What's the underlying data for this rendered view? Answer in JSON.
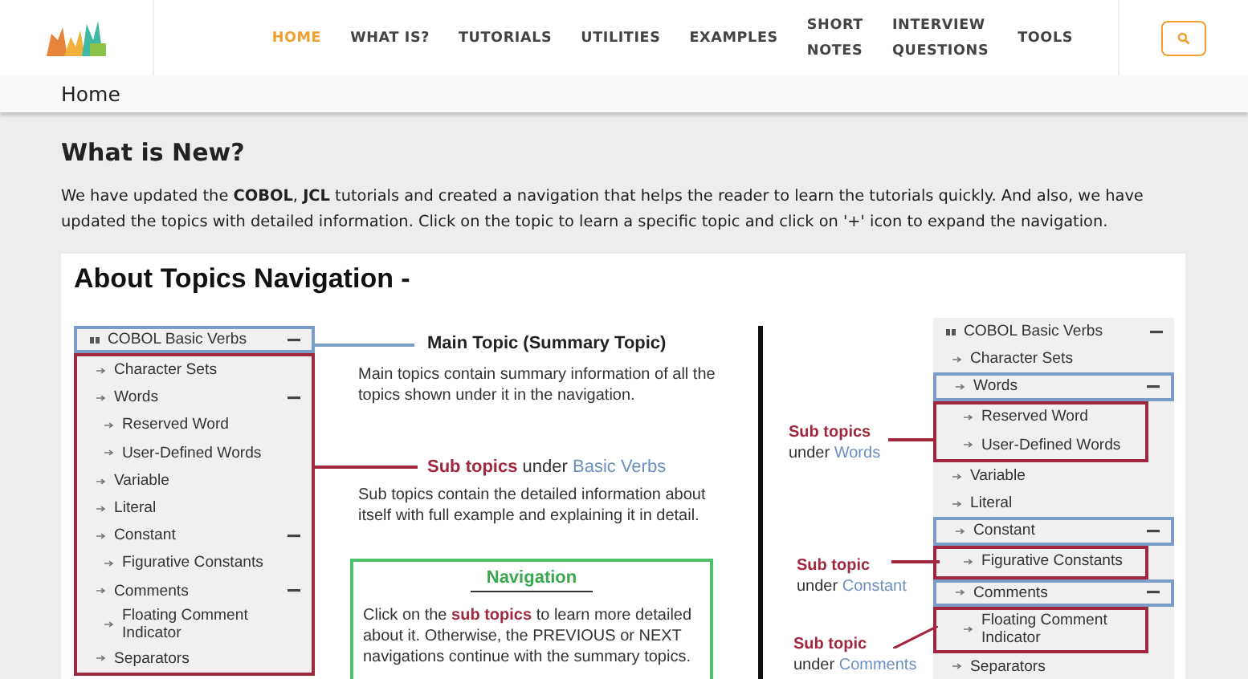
{
  "header": {
    "nav": [
      {
        "label": "HOME",
        "selected": true,
        "kind": "single"
      },
      {
        "label": "WHAT IS?",
        "selected": false,
        "kind": "single"
      },
      {
        "label": "TUTORIALS",
        "selected": false,
        "kind": "single"
      },
      {
        "label": "UTILITIES",
        "selected": false,
        "kind": "single"
      },
      {
        "label": "EXAMPLES",
        "selected": false,
        "kind": "single"
      },
      {
        "label": "SHORT NOTES",
        "selected": false,
        "kind": "stacked"
      },
      {
        "label": "INTERVIEW QUESTIONS",
        "selected": false,
        "kind": "stacked"
      },
      {
        "label": "TOOLS",
        "selected": false,
        "kind": "single"
      }
    ]
  },
  "breadcrumb": "Home",
  "heading": "What is New?",
  "intro": "We have updated the **COBOL**, **JCL** tutorials and created a navigation that helps the reader to learn the tutorials quickly. And also, we have updated the topics with detailed information. Click on the topic to learn a specific topic and click on '+' icon to expand the navigation.",
  "figure": {
    "title": "About Topics Navigation -",
    "left_tree": [
      {
        "label": "COBOL Basic Verbs",
        "expanded": true,
        "highlighted": true,
        "children": [
          {
            "label": "Character Sets",
            "expanded": false,
            "highlighted": false
          },
          {
            "label": "Words",
            "expanded": true,
            "highlighted": false,
            "children": [
              {
                "label": "Reserved Word",
                "expanded": false,
                "highlighted": false
              },
              {
                "label": "User-Defined Words",
                "expanded": false,
                "highlighted": false
              }
            ]
          },
          {
            "label": "Variable",
            "expanded": false,
            "highlighted": false
          },
          {
            "label": "Literal",
            "expanded": false,
            "highlighted": false
          },
          {
            "label": "Constant",
            "expanded": true,
            "highlighted": false,
            "children": [
              {
                "label": "Figurative Constants",
                "expanded": false,
                "highlighted": false
              }
            ]
          },
          {
            "label": "Comments",
            "expanded": true,
            "highlighted": false,
            "children": [
              {
                "label": "Floating Comment Indicator",
                "expanded": false,
                "highlighted": false
              }
            ]
          },
          {
            "label": "Separators",
            "expanded": false,
            "highlighted": false
          }
        ]
      }
    ],
    "main_topic": {
      "heading": "Main Topic (Summary Topic)",
      "description": "Main topics contain summary information of all the topics shown under it in the navigation."
    },
    "sub_topics": {
      "label": [
        {
          "text": "Sub topics",
          "color": "#a0283c"
        },
        {
          "text": " under ",
          "color": "#333333"
        },
        {
          "text": "Basic Verbs",
          "color": "#6d8fc0"
        }
      ],
      "description": "Sub topics contain the detailed information about itself with full example and explaining it in detail."
    },
    "navigation_box": {
      "title": "Navigation",
      "text": [
        {
          "text": "Click on the ",
          "color": "#333333"
        },
        {
          "text": "sub topics",
          "color": "#a0283c"
        },
        {
          "text": " to learn more detailed about it. Otherwise, the PREVIOUS or NEXT navigations continue with the summary topics.",
          "color": "#333333"
        }
      ]
    },
    "right_tree": [
      {
        "label": "COBOL Basic Verbs",
        "expanded": true,
        "highlighted": false,
        "children": [
          {
            "label": "Character Sets",
            "expanded": false,
            "highlighted": false
          },
          {
            "label": "Words",
            "expanded": true,
            "highlighted": true,
            "children": [
              {
                "label": "Reserved Word",
                "expanded": false,
                "highlighted": false
              },
              {
                "label": "User-Defined Words",
                "expanded": false,
                "highlighted": false
              }
            ]
          },
          {
            "label": "Variable",
            "expanded": false,
            "highlighted": false
          },
          {
            "label": "Literal",
            "expanded": false,
            "highlighted": false
          },
          {
            "label": "Constant",
            "expanded": true,
            "highlighted": true,
            "children": [
              {
                "label": "Figurative Constants",
                "expanded": false,
                "highlighted": false
              }
            ]
          },
          {
            "label": "Comments",
            "expanded": true,
            "highlighted": true,
            "children": [
              {
                "label": "Floating Comment Indicator",
                "expanded": false,
                "highlighted": false
              }
            ]
          },
          {
            "label": "Separators",
            "expanded": false,
            "highlighted": false
          }
        ]
      }
    ],
    "right_callouts": [
      {
        "title": "Sub topics",
        "under": "under",
        "target": "Words"
      },
      {
        "title": "Sub topic",
        "under": "under",
        "target": "Constant"
      },
      {
        "title": "Sub topic",
        "under": "under",
        "target": "Comments"
      }
    ]
  }
}
